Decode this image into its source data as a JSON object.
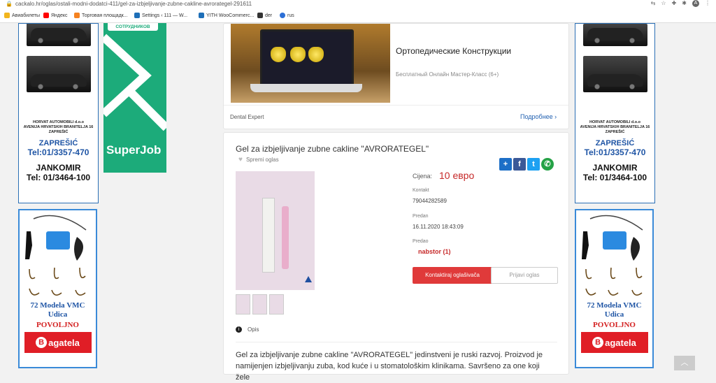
{
  "browser": {
    "url": "cackalo.hr/oglas/ostali-modni-dodatci-411/gel-za-izbjeljivanje-zubne-cakline-avrorategel-291611",
    "profile_initial": "A",
    "bookmarks": [
      "Авиабилеты",
      "Яндекс",
      "Торговая площадк...",
      "Settings ‹ 111 — W...",
      "YITH WooCommerc...",
      "der",
      "rus"
    ]
  },
  "ads": {
    "car": {
      "company": "HORVAT AUTOMOBILI d.o.o",
      "address": "AVENIJA HRVATSKIH BRANITELJA 16",
      "city": "ZAPREŠIĆ",
      "city_big": "ZAPREŠIĆ",
      "tel1": "Tel:01/3357-470",
      "name": "JANKOMIR",
      "tel2": "Tel: 01/3464-100"
    },
    "fish": {
      "title1": "72 Modela VMC",
      "title2": "Udica",
      "povoljno": "POVOLJNO",
      "brand": "agatela",
      "brand_initial": "B"
    },
    "superjob": {
      "tag": "СОТРУДНИКОВ",
      "logo": "SuperJob"
    }
  },
  "top_ad": {
    "title": "Ортопедические Конструкции",
    "subtitle": "Бесплатный Онлайн Мастер-Класс (6+)",
    "brand": "Dental Expert",
    "more": "Подробнее ›"
  },
  "listing": {
    "title": "Gel za izbjeljivanje zubne cakline \"AVRORATEGEL\"",
    "save": "Spremi oglas",
    "price_label": "Cijena:",
    "price": "10 евро",
    "contact_label": "Kontakt",
    "contact": "79044282589",
    "posted_label": "Predan",
    "posted": "16.11.2020 18:43:09",
    "seller_label": "Predao",
    "seller": "nabstor (1)",
    "contact_button": "Kontaktiraj oglašivača",
    "report_button": "Prijavi oglas",
    "opis": "Opis",
    "description": "Gel za izbjeljivanje zubne cakline \"AVRORATEGEL\" jedinstveni je ruski razvoj. Proizvod je namijenjen izbjeljivanju zuba, kod kuće i u stomatološkim klinikama. Savršeno za one koji žele"
  },
  "colors": {
    "accent_red": "#e03a3a",
    "link_blue": "#1f5fb0",
    "superjob_green": "#1cab7a"
  }
}
